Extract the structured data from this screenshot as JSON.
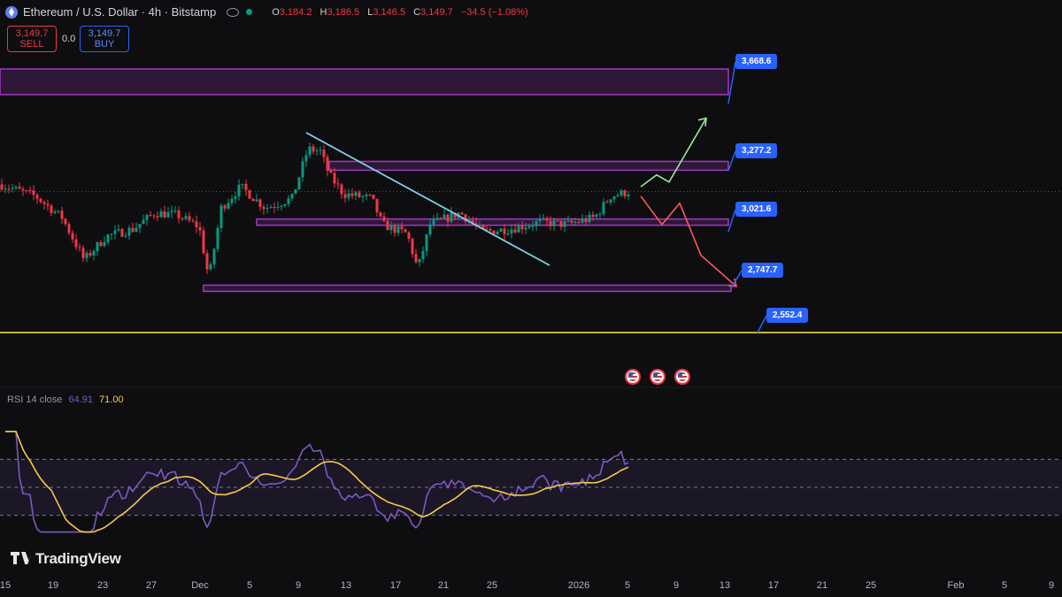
{
  "header": {
    "title": "Ethereum / U.S. Dollar · 4h · Bitstamp",
    "ohlc": {
      "o_label": "O",
      "o": "3,184.2",
      "h_label": "H",
      "h": "3,186.5",
      "l_label": "L",
      "l": "3,146.5",
      "c_label": "C",
      "c": "3,149.7",
      "change": "−34.5 (−1.08%)"
    }
  },
  "trade": {
    "sell_price": "3,149.7",
    "sell_label": "SELL",
    "spread": "0.0",
    "buy_price": "3,149.7",
    "buy_label": "BUY"
  },
  "colors": {
    "background": "#0e0e10",
    "up": "#089981",
    "down": "#f23645",
    "zone": "#a23ac2",
    "label": "#2962ff",
    "rsi": "#7e57c2",
    "rsi_ma": "#f7c948",
    "trendline": "#7fd3e8",
    "support_line": "#ffeb3b"
  },
  "chart_data": {
    "type": "candlestick",
    "symbol": "Ethereum / U.S. Dollar",
    "interval": "4h",
    "exchange": "Bitstamp",
    "x_ticks": [
      "15",
      "19",
      "23",
      "27",
      "Dec",
      "5",
      "9",
      "13",
      "17",
      "21",
      "25",
      "2026",
      "5",
      "9",
      "13",
      "17",
      "21",
      "25",
      "Feb",
      "5",
      "9"
    ],
    "price_levels": [
      {
        "label": "3,668.6",
        "value": 3668.6
      },
      {
        "label": "3,277.2",
        "value": 3277.2
      },
      {
        "label": "3,021.6",
        "value": 3021.6
      },
      {
        "label": "2,747.7",
        "value": 2747.7
      },
      {
        "label": "2,552.4",
        "value": 2552.4
      }
    ],
    "zones": [
      {
        "low": 3560,
        "high": 3668.6
      },
      {
        "low": 3240,
        "high": 3277.2
      },
      {
        "low": 3010,
        "high": 3030
      },
      {
        "low": 2730,
        "high": 2750
      }
    ],
    "support_line": 2552.4,
    "last_price": 3149.7,
    "scenarios": [
      {
        "type": "bullish",
        "points": [
          3170,
          3220,
          3190,
          3460
        ]
      },
      {
        "type": "bearish",
        "points": [
          3130,
          3010,
          3100,
          2880,
          2747.7
        ]
      }
    ],
    "rsi": {
      "label": "RSI",
      "length": "14",
      "source": "close",
      "value": "64.91",
      "ma_value": "71.00",
      "levels": [
        70,
        50,
        30
      ]
    }
  },
  "branding": {
    "logo_text": "TradingView"
  }
}
